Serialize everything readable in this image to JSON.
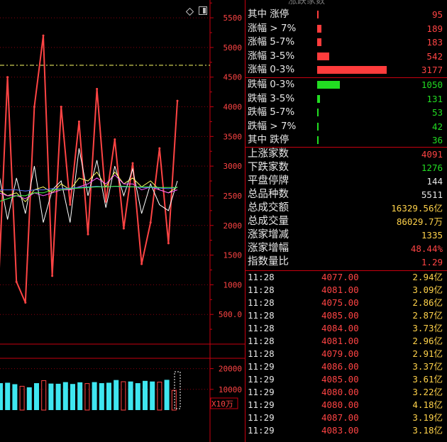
{
  "header": {
    "title": "涨跌家数"
  },
  "toolbar": {
    "diamond_icon": "diamond-icon",
    "panel_icon": "panel-toggle-icon"
  },
  "chart_data": {
    "type": "line",
    "ylim": [
      0,
      5800
    ],
    "y_ticks": [
      "5500",
      "5000",
      "4500",
      "4000",
      "3500",
      "3000",
      "2500",
      "2000",
      "1500",
      "1000",
      "500.0"
    ],
    "y_tick_values": [
      5500,
      5000,
      4500,
      4000,
      3500,
      3000,
      2500,
      2000,
      1500,
      1000,
      500
    ],
    "reference_line": 4700,
    "series": [
      {
        "color": "#ff4444",
        "values": [
          1000,
          4500,
          1050,
          700,
          4000,
          5200,
          1150,
          4000,
          2350,
          3750,
          1850,
          4300,
          2400,
          3450,
          1950,
          3050,
          1350,
          2050,
          3300,
          1700,
          4100
        ]
      },
      {
        "color": "#ffffff",
        "values": [
          2900,
          2100,
          2800,
          2200,
          3000,
          2050,
          2600,
          2750,
          2050,
          3300,
          2500,
          3100,
          2300,
          3000,
          2500,
          2950,
          2200,
          2700,
          2350,
          2250,
          2750
        ]
      },
      {
        "color": "#ffff66",
        "values": [
          2600,
          2500,
          2550,
          2400,
          2600,
          2650,
          2550,
          2700,
          2600,
          2800,
          2750,
          2900,
          2650,
          2900,
          2700,
          2800,
          2650,
          2750,
          2600,
          2550,
          2650
        ]
      },
      {
        "color": "#ff55ff",
        "values": [
          2550,
          2500,
          2500,
          2450,
          2550,
          2500,
          2550,
          2600,
          2600,
          2650,
          2700,
          2800,
          2700,
          2850,
          2700,
          2700,
          2600,
          2650,
          2600,
          2550,
          2600
        ]
      },
      {
        "color": "#5577ff",
        "values": [
          2600,
          2600,
          2600,
          2580,
          2600,
          2600,
          2620,
          2620,
          2630,
          2640,
          2650,
          2660,
          2650,
          2660,
          2650,
          2650,
          2640,
          2640,
          2630,
          2620,
          2640
        ]
      },
      {
        "color": "#44ff44",
        "values": [
          2400,
          2450,
          2500,
          2500,
          2550,
          2550,
          2600,
          2600,
          2620,
          2630,
          2640,
          2650,
          2650,
          2660,
          2660,
          2650,
          2650,
          2650,
          2640,
          2640,
          2640
        ]
      }
    ],
    "volume": {
      "ylim": [
        0,
        25000
      ],
      "y_ticks": [
        "20000",
        "10000"
      ],
      "y_tick_values": [
        20000,
        10000
      ],
      "unit": "X10万",
      "values": [
        13000,
        13200,
        12500,
        11500,
        11000,
        13000,
        14200,
        12800,
        12700,
        13500,
        12600,
        13400,
        12800,
        13500,
        13000,
        13200,
        14500,
        13700,
        13800,
        13000,
        14100,
        13800,
        13500,
        14600,
        9500
      ],
      "colors": [
        "cyan",
        "cyan",
        "cyan",
        "red",
        "cyan",
        "cyan",
        "red",
        "cyan",
        "cyan",
        "cyan",
        "cyan",
        "cyan",
        "red",
        "cyan",
        "cyan",
        "cyan",
        "cyan",
        "red",
        "cyan",
        "cyan",
        "cyan",
        "cyan",
        "red",
        "cyan",
        "red"
      ]
    }
  },
  "up_stats": [
    {
      "label": "其中 涨停",
      "value": "95",
      "bar": 0.01
    },
    {
      "label": "涨幅 > 7%",
      "value": "189",
      "bar": 0.06
    },
    {
      "label": "涨幅 5-7%",
      "value": "183",
      "bar": 0.06
    },
    {
      "label": "涨幅 3-5%",
      "value": "542",
      "bar": 0.17
    },
    {
      "label": "涨幅 0-3%",
      "value": "3177",
      "bar": 1.0
    }
  ],
  "down_stats": [
    {
      "label": "跌幅 0-3%",
      "value": "1050",
      "bar": 0.33
    },
    {
      "label": "跌幅 3-5%",
      "value": "131",
      "bar": 0.04
    },
    {
      "label": "跌幅 5-7%",
      "value": "53",
      "bar": 0.02
    },
    {
      "label": "跌幅 > 7%",
      "value": "42",
      "bar": 0.015
    },
    {
      "label": "其中 跌停",
      "value": "36",
      "bar": 0.012
    }
  ],
  "summary": [
    {
      "label": "上涨家数",
      "value": "4091",
      "color": "red"
    },
    {
      "label": "下跌家数",
      "value": "1276",
      "color": "green"
    },
    {
      "label": "平盘停牌",
      "value": "144",
      "color": "white"
    },
    {
      "label": "总品种数",
      "value": "5511",
      "color": "white"
    },
    {
      "label": "总成交额",
      "value": "16329.56亿",
      "color": "yellow"
    },
    {
      "label": "总成交量",
      "value": "86029.7万",
      "color": "yellow"
    },
    {
      "label": "涨家增减",
      "value": "1335",
      "color": "yellow"
    },
    {
      "label": "涨家增幅",
      "value": "48.44%",
      "color": "red"
    },
    {
      "label": "指数量比",
      "value": "1.29",
      "color": "red"
    }
  ],
  "ticks": [
    {
      "time": "11:28",
      "price": "4077.00",
      "amount": "2.94亿"
    },
    {
      "time": "11:28",
      "price": "4081.00",
      "amount": "3.09亿"
    },
    {
      "time": "11:28",
      "price": "4075.00",
      "amount": "2.86亿"
    },
    {
      "time": "11:28",
      "price": "4085.00",
      "amount": "2.87亿"
    },
    {
      "time": "11:28",
      "price": "4084.00",
      "amount": "3.73亿"
    },
    {
      "time": "11:28",
      "price": "4081.00",
      "amount": "2.96亿"
    },
    {
      "time": "11:28",
      "price": "4079.00",
      "amount": "2.91亿"
    },
    {
      "time": "11:29",
      "price": "4086.00",
      "amount": "3.37亿"
    },
    {
      "time": "11:29",
      "price": "4085.00",
      "amount": "3.61亿"
    },
    {
      "time": "11:29",
      "price": "4080.00",
      "amount": "3.22亿"
    },
    {
      "time": "11:29",
      "price": "4080.00",
      "amount": "4.18亿"
    },
    {
      "time": "11:29",
      "price": "4087.00",
      "amount": "3.19亿"
    },
    {
      "time": "11:29",
      "price": "4083.00",
      "amount": "3.18亿"
    }
  ]
}
